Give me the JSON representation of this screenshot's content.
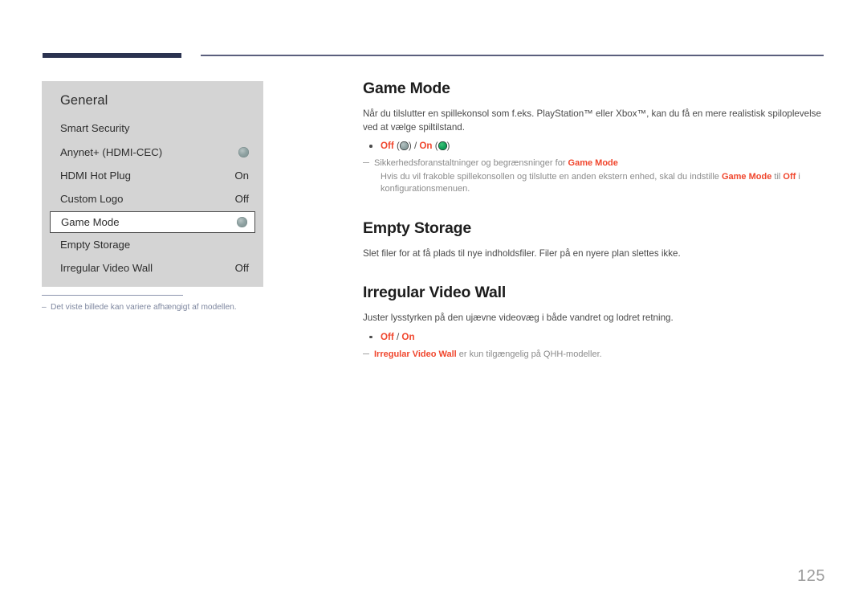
{
  "page": {
    "number": "125"
  },
  "osd": {
    "title": "General",
    "rows": [
      {
        "label": "Smart Security",
        "value": "",
        "indicator": "none"
      },
      {
        "label": "Anynet+ (HDMI-CEC)",
        "value": "",
        "indicator": "dot-gray"
      },
      {
        "label": "HDMI Hot Plug",
        "value": "On",
        "indicator": "none"
      },
      {
        "label": "Custom Logo",
        "value": "Off",
        "indicator": "none"
      },
      {
        "label": "Game Mode",
        "value": "",
        "indicator": "dot-gray",
        "selected": true
      },
      {
        "label": "Empty Storage",
        "value": "",
        "indicator": "none"
      },
      {
        "label": "Irregular Video Wall",
        "value": "Off",
        "indicator": "none"
      }
    ]
  },
  "caption": {
    "dash": "–",
    "text": "Det viste billede kan variere afhængigt af modellen."
  },
  "sections": {
    "game_mode": {
      "title": "Game Mode",
      "paragraph": "Når du tilslutter en spillekonsol som f.eks. PlayStation™ eller Xbox™, kan du få en mere realistisk spiloplevelse ved at vælge spiltilstand.",
      "option_off": "Off",
      "option_on": "On",
      "option_separator": " / ",
      "note_title_pre": "Sikkerhedsforanstaltninger og begrænsninger for ",
      "note_title_highlight": "Game Mode",
      "note_body_pre": "Hvis du vil frakoble spillekonsollen og tilslutte en anden ekstern enhed, skal du indstille ",
      "note_body_h1": "Game Mode",
      "note_body_mid": " til ",
      "note_body_h2": "Off",
      "note_body_post": " i konfigurationsmenuen."
    },
    "empty_storage": {
      "title": "Empty Storage",
      "paragraph": "Slet filer for at få plads til nye indholdsfiler. Filer på en nyere plan slettes ikke."
    },
    "irregular_video_wall": {
      "title": "Irregular Video Wall",
      "paragraph": "Juster lysstyrken på den ujævne videovæg i både vandret og lodret retning.",
      "option_off": "Off",
      "option_on": "On",
      "option_separator": " / ",
      "note_highlight": "Irregular Video Wall",
      "note_rest": " er kun tilgængelig på QHH-modeller."
    }
  },
  "colors": {
    "accent_red": "#f0462d",
    "header_bar": "#2b3350",
    "header_line": "#5a5f7d",
    "panel_bg": "#d4d4d4",
    "caption": "#7e879f",
    "page_number": "#9c9c9c"
  }
}
